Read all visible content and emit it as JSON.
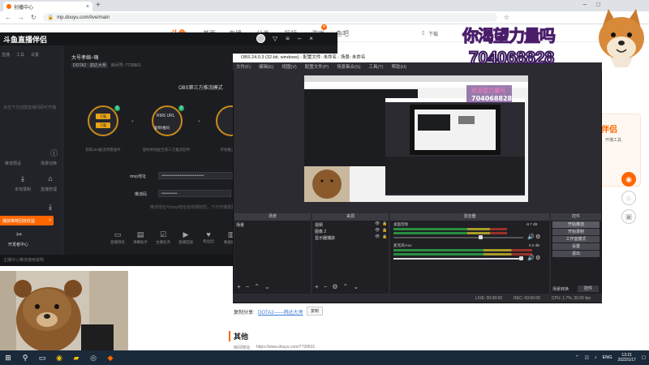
{
  "browser": {
    "tab_title": "创播中心",
    "url": "mp.douyu.com/live/main"
  },
  "douyu": {
    "nav": [
      "首页",
      "直播",
      "分类",
      "视频",
      "游戏",
      "鱼吧"
    ],
    "download": "下载",
    "side_title": "伴侣",
    "side_text": "开播工具",
    "share_label": "复制分享:",
    "share_link": "DOTA2——鸽达大师",
    "copy_btn": "复制",
    "section_title": "其他",
    "room_label": "房间地址:",
    "room_url": "https://www.douyu.com/7739501"
  },
  "tool": {
    "title": "斗鱼直播伴侣",
    "left_tabs": [
      "直播",
      "工具",
      "设置"
    ],
    "left_text": "点击下方创建直播间即可开播",
    "left_items": [
      "推流预设",
      "场景切换",
      "本地录制",
      "直播管理"
    ],
    "banner": "播放推荐回放收益",
    "bottom_label": "开发者中心",
    "room_title": "大号孝绵~嗨",
    "room_tag": "DOTA2 · 鸽达大师",
    "room_id": "房间号: 7739501",
    "obs_mode": "OBS第三方推流模式",
    "steps": [
      {
        "btn": "下载",
        "num": "1",
        "desc": "获取obs推流所需插件"
      },
      {
        "btn": "RMS URL",
        "num": "2",
        "desc": "复制并粘贴至第三方推流软件"
      },
      {
        "btn": "",
        "num": "",
        "desc": "开始推流开播"
      }
    ],
    "rtmp_label": "rtmp地址",
    "rtmp_value": "••••••••••••••••••••••••••••••",
    "key_label": "推流码",
    "key_value": "•••••••••••",
    "hint": "推流地址与rtmp地址有效期较短，下次开播需要重新获取",
    "bottom_tools": [
      "直播预览",
      "弹幕助手",
      "主播任务",
      "直播回放",
      "粉丝团",
      "数据统计",
      "更多功能"
    ],
    "footer": "主播中心推流使用说明"
  },
  "obs": {
    "title": "OBS 24.0.3 (32-bit, windows) - 配置文件: 未命名 - 场景: 未命名",
    "menu": [
      "文件(F)",
      "编辑(E)",
      "视图(V)",
      "配置文件(P)",
      "场景集合(S)",
      "工具(T)",
      "帮助(H)"
    ],
    "docks": [
      "场景",
      "来源",
      "混音器",
      "控件"
    ],
    "scenes": [
      "场景"
    ],
    "sources": [
      "视频",
      "图像 2",
      "显示器捕获"
    ],
    "mixer": [
      {
        "name": "桌面音频",
        "db": "-8.7 dB",
        "level": 0.78
      },
      {
        "name": "麦克风/Aux",
        "db": "0.0 dB",
        "level": 0.95
      }
    ],
    "controls": [
      "开始推流",
      "开始录制",
      "工作室模式",
      "设置",
      "退出"
    ],
    "transition": [
      "场景转换",
      "控件"
    ],
    "status": [
      "LIVE: 00:00:00",
      "REC: 00:00:00",
      "CPU: 1.7%, 30.00 fps"
    ]
  },
  "overlay": {
    "slogan": "你渴望力量吗",
    "number": "704068828"
  },
  "taskbar": {
    "lang": "ENG",
    "time": "13:21",
    "date": "2022/1/17"
  }
}
